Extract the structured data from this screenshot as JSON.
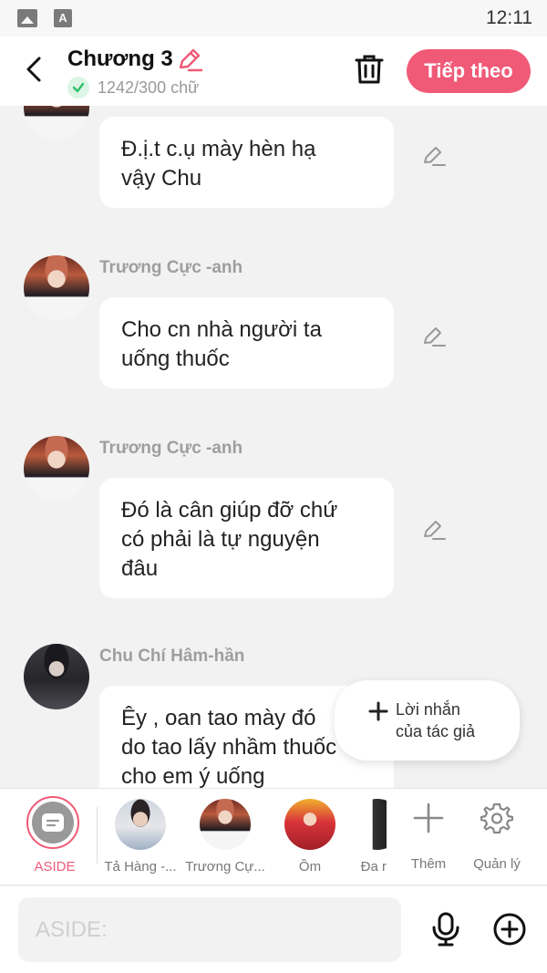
{
  "status_bar": {
    "time": "12:11",
    "icons": [
      "image-icon",
      "font-a-icon"
    ]
  },
  "header": {
    "chapter_title": "Chương 3",
    "word_count": "1242/300 chữ",
    "next_label": "Tiếp theo"
  },
  "messages": [
    {
      "sender": "",
      "text_lines": [
        "Đ.ị.t c.ụ mày hèn hạ",
        "vậy Chu"
      ]
    },
    {
      "sender": "Trương Cực -anh",
      "text_lines": [
        "Cho cn nhà người ta",
        "uống thuốc"
      ]
    },
    {
      "sender": "Trương Cực -anh",
      "text_lines": [
        "Đó là cân giúp đỡ chứ",
        "có phải là tự nguyện",
        "đâu"
      ]
    },
    {
      "sender": "Chu Chí Hâm-hần",
      "text_lines": [
        "Êy , oan tao mày đó",
        "do tao lấy nhầm thuốc",
        "cho em ý uống"
      ]
    }
  ],
  "author_note": {
    "line1": "Lời nhắn",
    "line2": "của tác giả"
  },
  "characters": [
    {
      "name": "ASIDE",
      "selected": true
    },
    {
      "name": "Tả Hàng -..."
    },
    {
      "name": "Trương Cự..."
    },
    {
      "name": "Ồm"
    },
    {
      "name": "Đa r"
    }
  ],
  "tools": {
    "add": "Thêm",
    "manage": "Quản lý"
  },
  "input": {
    "placeholder": "ASIDE:"
  },
  "colors": {
    "accent": "#f05a77",
    "check_green": "#2fbf6a",
    "muted": "#9e9e9e"
  }
}
